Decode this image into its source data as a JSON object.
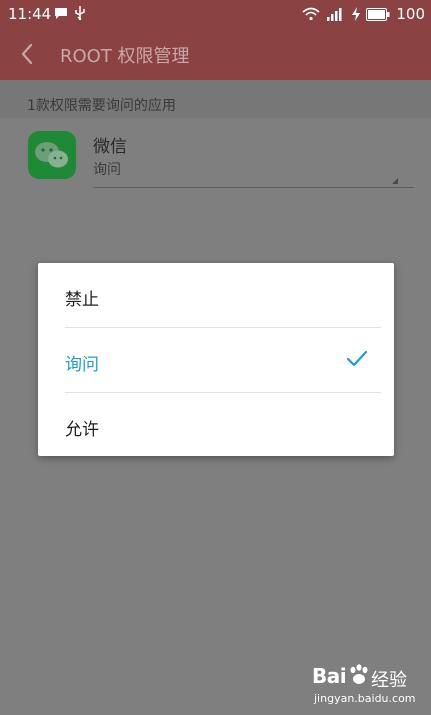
{
  "status_bar": {
    "time": "11:44",
    "battery": "100"
  },
  "app_bar": {
    "title": "ROOT 权限管理"
  },
  "section": {
    "header": "1款权限需要询问的应用"
  },
  "app_item": {
    "name": "微信",
    "permission": "询问",
    "icon_color": "#1f8a36"
  },
  "dialog": {
    "options": [
      {
        "label": "禁止",
        "selected": false
      },
      {
        "label": "询问",
        "selected": true
      },
      {
        "label": "允许",
        "selected": false
      }
    ],
    "accent_color": "#1f9bd6"
  },
  "watermark": {
    "brand": "Bai",
    "brand_suffix": "经验",
    "domain": "jingyan.baidu.com"
  }
}
